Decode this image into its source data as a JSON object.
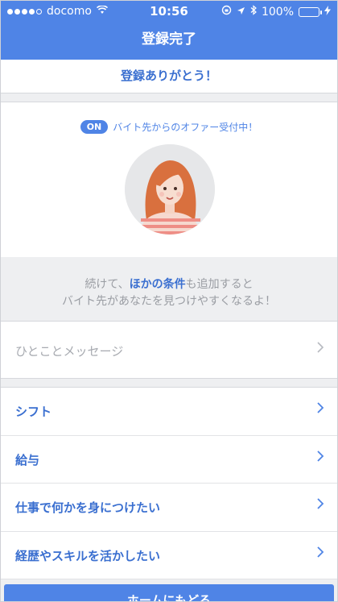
{
  "status": {
    "carrier": "docomo",
    "time": "10:56",
    "battery": "100%"
  },
  "nav": {
    "title": "登録完了"
  },
  "thanks": "登録ありがとう！",
  "offer": {
    "badge": "ON",
    "text": "バイト先からのオファー受付中！"
  },
  "info": {
    "line1_pre": "続けて、",
    "line1_highlight": "ほかの条件",
    "line1_post": "も追加すると",
    "line2": "バイト先があなたを見つけやすくなるよ！"
  },
  "message": {
    "placeholder": "ひとことメッセージ"
  },
  "conditions": [
    {
      "label": "シフト"
    },
    {
      "label": "給与"
    },
    {
      "label": "仕事で何かを身につけたい"
    },
    {
      "label": "経歴やスキルを活かしたい"
    }
  ],
  "home_button": "ホームにもどる",
  "colors": {
    "brand_blue": "#4f84e6",
    "accent_text": "#3a6fd0"
  }
}
